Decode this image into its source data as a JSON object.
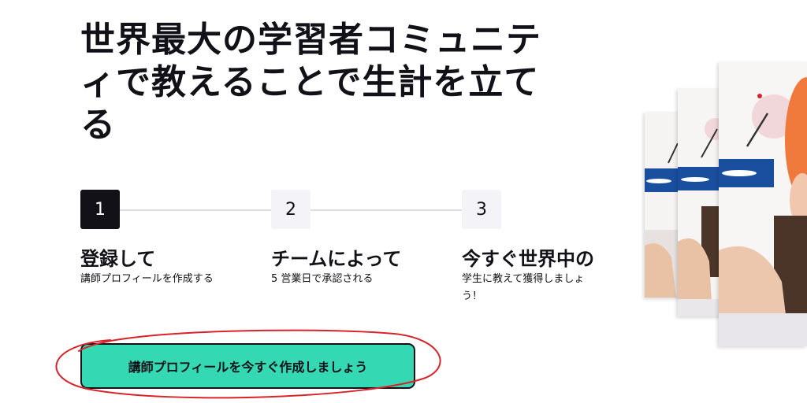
{
  "hero": {
    "title_lines": [
      "世界最大の学習者コミュニテ",
      "ィで教えることで生計を立て",
      "る"
    ]
  },
  "steps": [
    {
      "number": "1",
      "title": "登録して",
      "description": "講師プロフィールを作成する",
      "active": true
    },
    {
      "number": "2",
      "title": "チームによって",
      "description": "5 営業日で承認される",
      "active": false
    },
    {
      "number": "3",
      "title": "今すぐ世界中の",
      "description": "学生に教えて獲得しましょう！",
      "active": false
    }
  ],
  "cta": {
    "label": "講師プロフィールを今すぐ作成しましょう"
  },
  "colors": {
    "accent": "#34d9b4",
    "dark": "#121117",
    "annotation": "#d6242a"
  },
  "images": {
    "description_icon": "tutor-photo-stack"
  }
}
